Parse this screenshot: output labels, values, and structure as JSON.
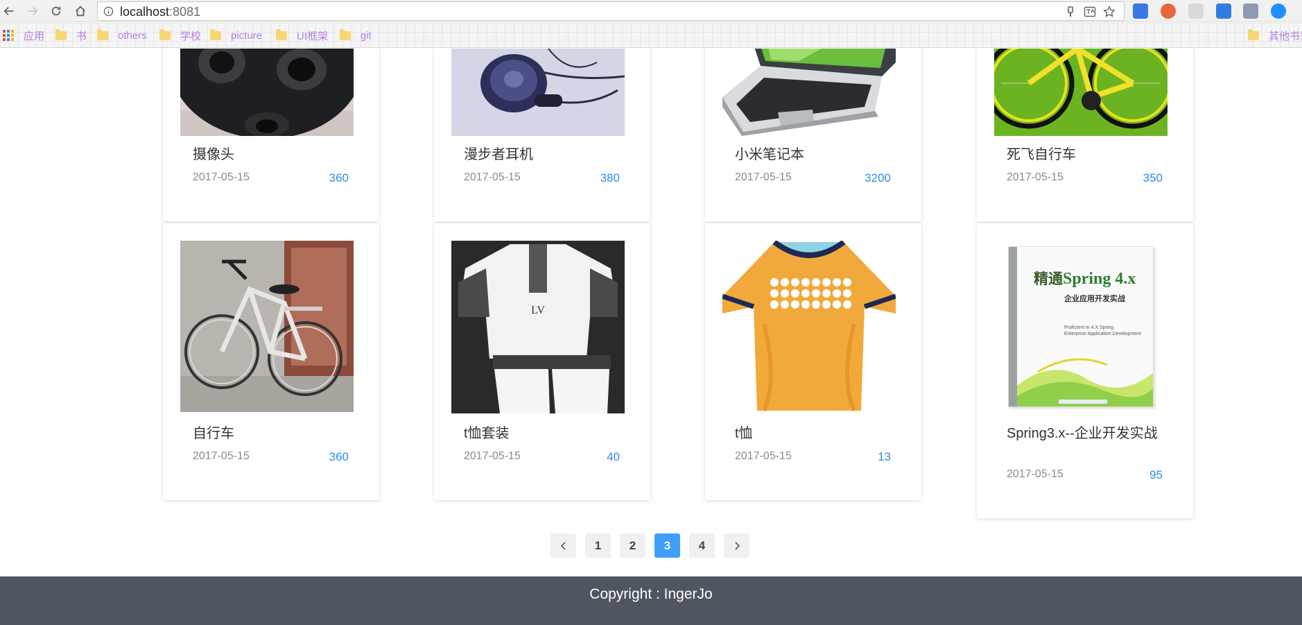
{
  "browser": {
    "url_host": "localhost",
    "url_port": ":8081",
    "bookmarks": [
      {
        "label": "应用",
        "kind": "apps"
      },
      {
        "label": "书",
        "kind": "folder"
      },
      {
        "label": "others",
        "kind": "folder"
      },
      {
        "label": "学校",
        "kind": "folder"
      },
      {
        "label": "picture",
        "kind": "folder"
      },
      {
        "label": "UI框架",
        "kind": "folder"
      },
      {
        "label": "git",
        "kind": "folder"
      }
    ],
    "other_bookmarks": "其他书签"
  },
  "products": [
    {
      "title": "摄像头",
      "date": "2017-05-15",
      "price": "360",
      "image": "camera-image"
    },
    {
      "title": "漫步者耳机",
      "date": "2017-05-15",
      "price": "380",
      "image": "headphones-image"
    },
    {
      "title": "小米笔记本",
      "date": "2017-05-15",
      "price": "3200",
      "image": "laptop-image"
    },
    {
      "title": "死飞自行车",
      "date": "2017-05-15",
      "price": "350",
      "image": "fixie-bike-image"
    },
    {
      "title": "自行车",
      "date": "2017-05-15",
      "price": "360",
      "image": "bicycle-image"
    },
    {
      "title": "t恤套装",
      "date": "2017-05-15",
      "price": "40",
      "image": "tshirt-set-image"
    },
    {
      "title": "t恤",
      "date": "2017-05-15",
      "price": "13",
      "image": "tshirt-image"
    },
    {
      "title": "Spring3.x--企业开发实战",
      "date": "2017-05-15",
      "price": "95",
      "image": "book-cover-image"
    }
  ],
  "book_cover": {
    "title_cn": "精通",
    "title_en": "Spring 4.x",
    "subtitle": "企业应用开发实战",
    "line1": "Proficient in 4.X Spring",
    "line2": "Enterprise Application Development"
  },
  "pagination": {
    "prev_icon": "chevron-left-icon",
    "next_icon": "chevron-right-icon",
    "pages": [
      "1",
      "2",
      "3",
      "4"
    ],
    "current": "3"
  },
  "footer": {
    "copyright": "Copyright : IngerJo"
  },
  "colors": {
    "accent": "#2d8cf0",
    "active_page": "#409eff",
    "footer_bg": "#4f5660"
  }
}
